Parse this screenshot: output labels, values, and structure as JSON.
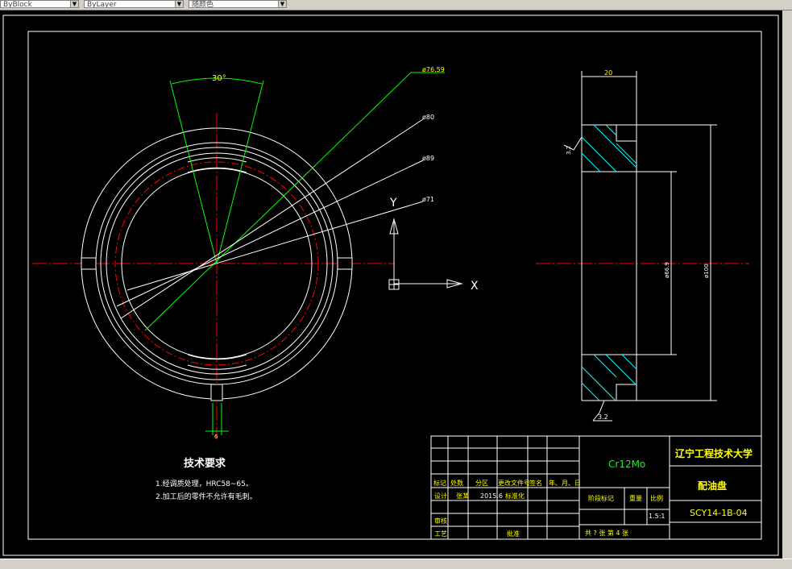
{
  "toolbar": {
    "linetype_value": "ByBlock",
    "lineweight_value": "ByLayer",
    "plotstyle_value": "随颜色"
  },
  "drawing": {
    "dim_angle": "30°",
    "dim_d1": "ø76.59",
    "dim_d2": "ø80",
    "dim_d3": "ø89",
    "dim_d4": "ø71",
    "dim_width": "20",
    "dim_inner": "ø66.9",
    "dim_outer": "ø100",
    "dim_slot": "6",
    "roughness_1": "3.2",
    "roughness_2": "3.2",
    "ucs_x": "X",
    "ucs_y": "Y"
  },
  "tech_req": {
    "title": "技术要求",
    "line1": "1.经调质处理，HRC58~65。",
    "line2": "2.加工后的零件不允许有毛刺。"
  },
  "title_block": {
    "material": "Cr12Mo",
    "school": "辽宁工程技术大学",
    "part_name": "配油盘",
    "drawing_no": "SCY14-1B-04",
    "h_mark": "标记",
    "h_count": "处数",
    "h_zone": "分区",
    "h_docno": "更改文件号",
    "h_sign": "签名",
    "h_date": "年、月、日",
    "design_label": "设计",
    "designer": "张某",
    "design_date": "2015.6",
    "std_label": "标准化",
    "check_label": "审核",
    "process_label": "工艺",
    "approve_label": "批准",
    "stage_label": "阶段标记",
    "weight_label": "重量",
    "scale_label": "比例",
    "scale_value": "1.5:1",
    "sheets_text": "共  ?  张      第  4  张"
  }
}
